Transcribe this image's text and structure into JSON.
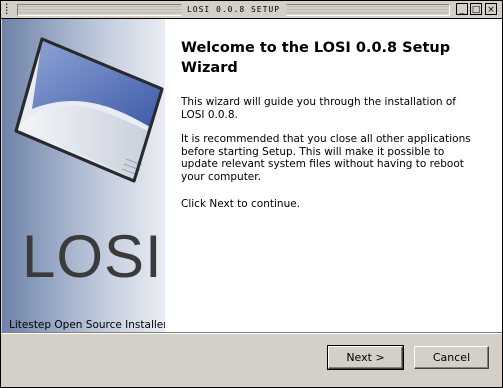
{
  "window": {
    "title": "LOSI 0.0.8 SETUP",
    "minimize_glyph": "_",
    "maximize_glyph": "□",
    "close_glyph": "×"
  },
  "sidebar": {
    "logo_word": "LOSI",
    "subtitle": "Litestep Open Source Installer"
  },
  "welcome": {
    "heading": "Welcome to the LOSI 0.0.8 Setup Wizard",
    "paragraphs": [
      "This wizard will guide you through the installation of LOSI 0.0.8.",
      "It is recommended that you close all other applications before starting Setup. This will make it possible to update relevant system files without having to reboot your computer.",
      "Click Next to continue."
    ]
  },
  "buttons": {
    "next": "Next >",
    "cancel": "Cancel"
  }
}
